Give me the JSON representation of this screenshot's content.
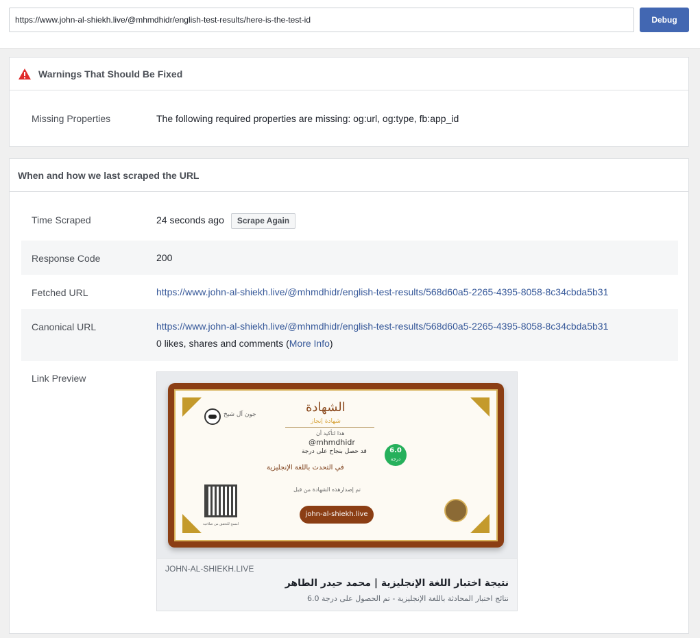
{
  "toolbar": {
    "url_value": "https://www.john-al-shiekh.live/@mhmdhidr/english-test-results/here-is-the-test-id",
    "debug_label": "Debug",
    "accent": "#4267b2"
  },
  "warnings": {
    "title": "Warnings That Should Be Fixed",
    "icon": "warning-triangle-icon",
    "icon_color": "#e02b2b",
    "rows": [
      {
        "label": "Missing Properties",
        "value": "The following required properties are missing: og:url, og:type, fb:app_id"
      }
    ]
  },
  "scrape": {
    "title": "When and how we last scraped the URL",
    "time_label": "Time Scraped",
    "time_value": "24 seconds ago",
    "scrape_again": "Scrape Again",
    "response_label": "Response Code",
    "response_value": "200",
    "fetched_label": "Fetched URL",
    "fetched_value": "https://www.john-al-shiekh.live/@mhmdhidr/english-test-results/568d60a5-2265-4395-8058-8c34cbda5b31",
    "canonical_label": "Canonical URL",
    "canonical_value": "https://www.john-al-shiekh.live/@mhmdhidr/english-test-results/568d60a5-2265-4395-8058-8c34cbda5b31",
    "engagement_prefix": "0 likes, shares and comments (",
    "more_info": "More Info",
    "engagement_suffix": ")",
    "preview_label": "Link Preview"
  },
  "preview": {
    "certificate": {
      "title": "الشهادة",
      "subtitle": "شهادة إنجاز",
      "brand": "جون آل   شيخ",
      "this_certifies": "هذا   لتأكيد أن",
      "name": "@mhmdhidr",
      "achieved": "قد  حصل   بنجاح  على درجة",
      "phrase": "في       التحدث       باللغة         الإنجليزية",
      "score": "6.0",
      "score_unit": "درجة",
      "issued": "تم  إصدارهذه   الشهادة من    قبل",
      "domain_pill": "john-al-shiekh.live",
      "qr_caption": "امسح   للتحقق من   صلاحية"
    },
    "domain": "JOHN-AL-SHIEKH.LIVE",
    "title": "نتيجة اختبار اللغة الإنجليزية | محمد حيدر الطاهر",
    "description": "نتائج اختبار المحادثة باللغة الإنجليزية - تم الحصول على درجة 6.0"
  }
}
